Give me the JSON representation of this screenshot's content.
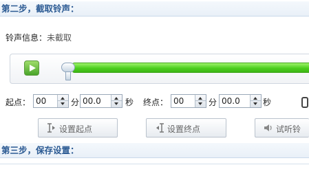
{
  "step2": {
    "title": "第二步，截取铃声："
  },
  "info": {
    "label": "铃声信息：",
    "value": "未截取"
  },
  "player": {
    "progress": 0.0
  },
  "start": {
    "label": "起点：",
    "minutes": "00",
    "min_unit": "分",
    "seconds": "00.0",
    "sec_unit": "秒"
  },
  "end": {
    "label": "终点：",
    "minutes": "00",
    "min_unit": "分",
    "seconds": "00.0",
    "sec_unit": "秒"
  },
  "buttons": {
    "set_start": "设置起点",
    "set_end": "设置终点",
    "preview": "试听铃"
  },
  "step3": {
    "title": "第三步，保存设置："
  }
}
